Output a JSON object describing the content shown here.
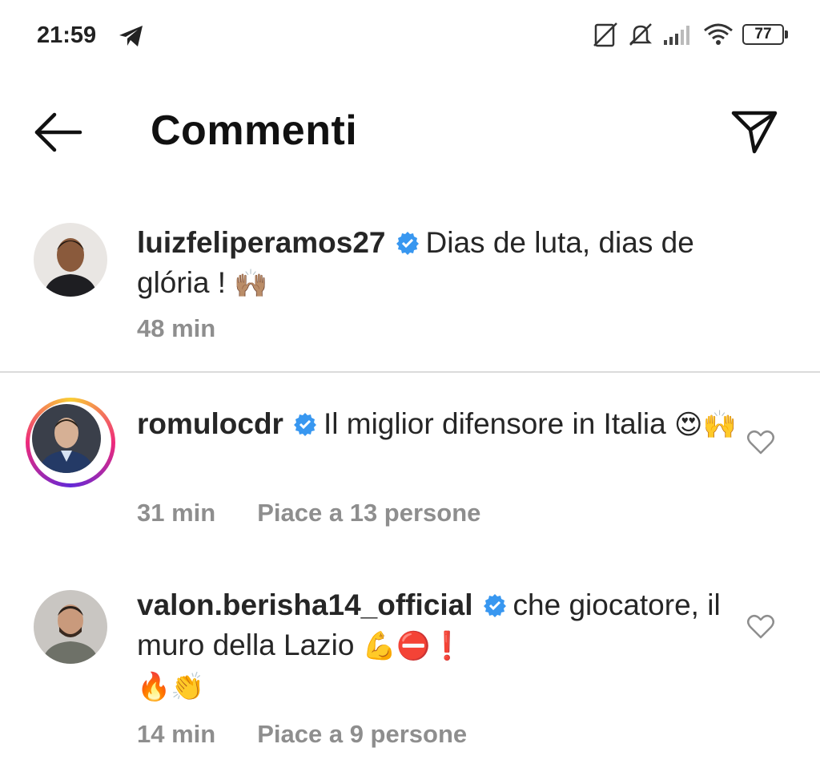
{
  "status_bar": {
    "time": "21:59",
    "battery": "77",
    "icons": [
      "telegram-icon",
      "no-sim-icon",
      "mute-icon",
      "signal-icon",
      "wifi-icon",
      "battery-icon"
    ]
  },
  "header": {
    "title": "Commenti",
    "back_icon": "arrow-left-icon",
    "share_icon": "paper-plane-icon"
  },
  "comments": [
    {
      "username": "luizfeliperamos27",
      "verified": true,
      "text": "Dias de luta, dias de glória !",
      "emoji": "🙌🏽",
      "time": "48 min",
      "likes": ""
    },
    {
      "username": "romulocdr",
      "verified": true,
      "text": "Il miglior difensore in Italia",
      "emoji": "😍🙌",
      "time": "31 min",
      "likes": "Piace a 13 persone"
    },
    {
      "username": "valon.berisha14_official",
      "verified": true,
      "text": "che giocatore, il muro della Lazio",
      "emoji": "💪⛔❗",
      "emoji2": "🔥👏",
      "time": "14 min",
      "likes": "Piace a 9 persone"
    }
  ],
  "colors": {
    "verified_blue": "#3897f0",
    "meta_gray": "#8e8e8e",
    "divider": "#dbdbdb"
  }
}
